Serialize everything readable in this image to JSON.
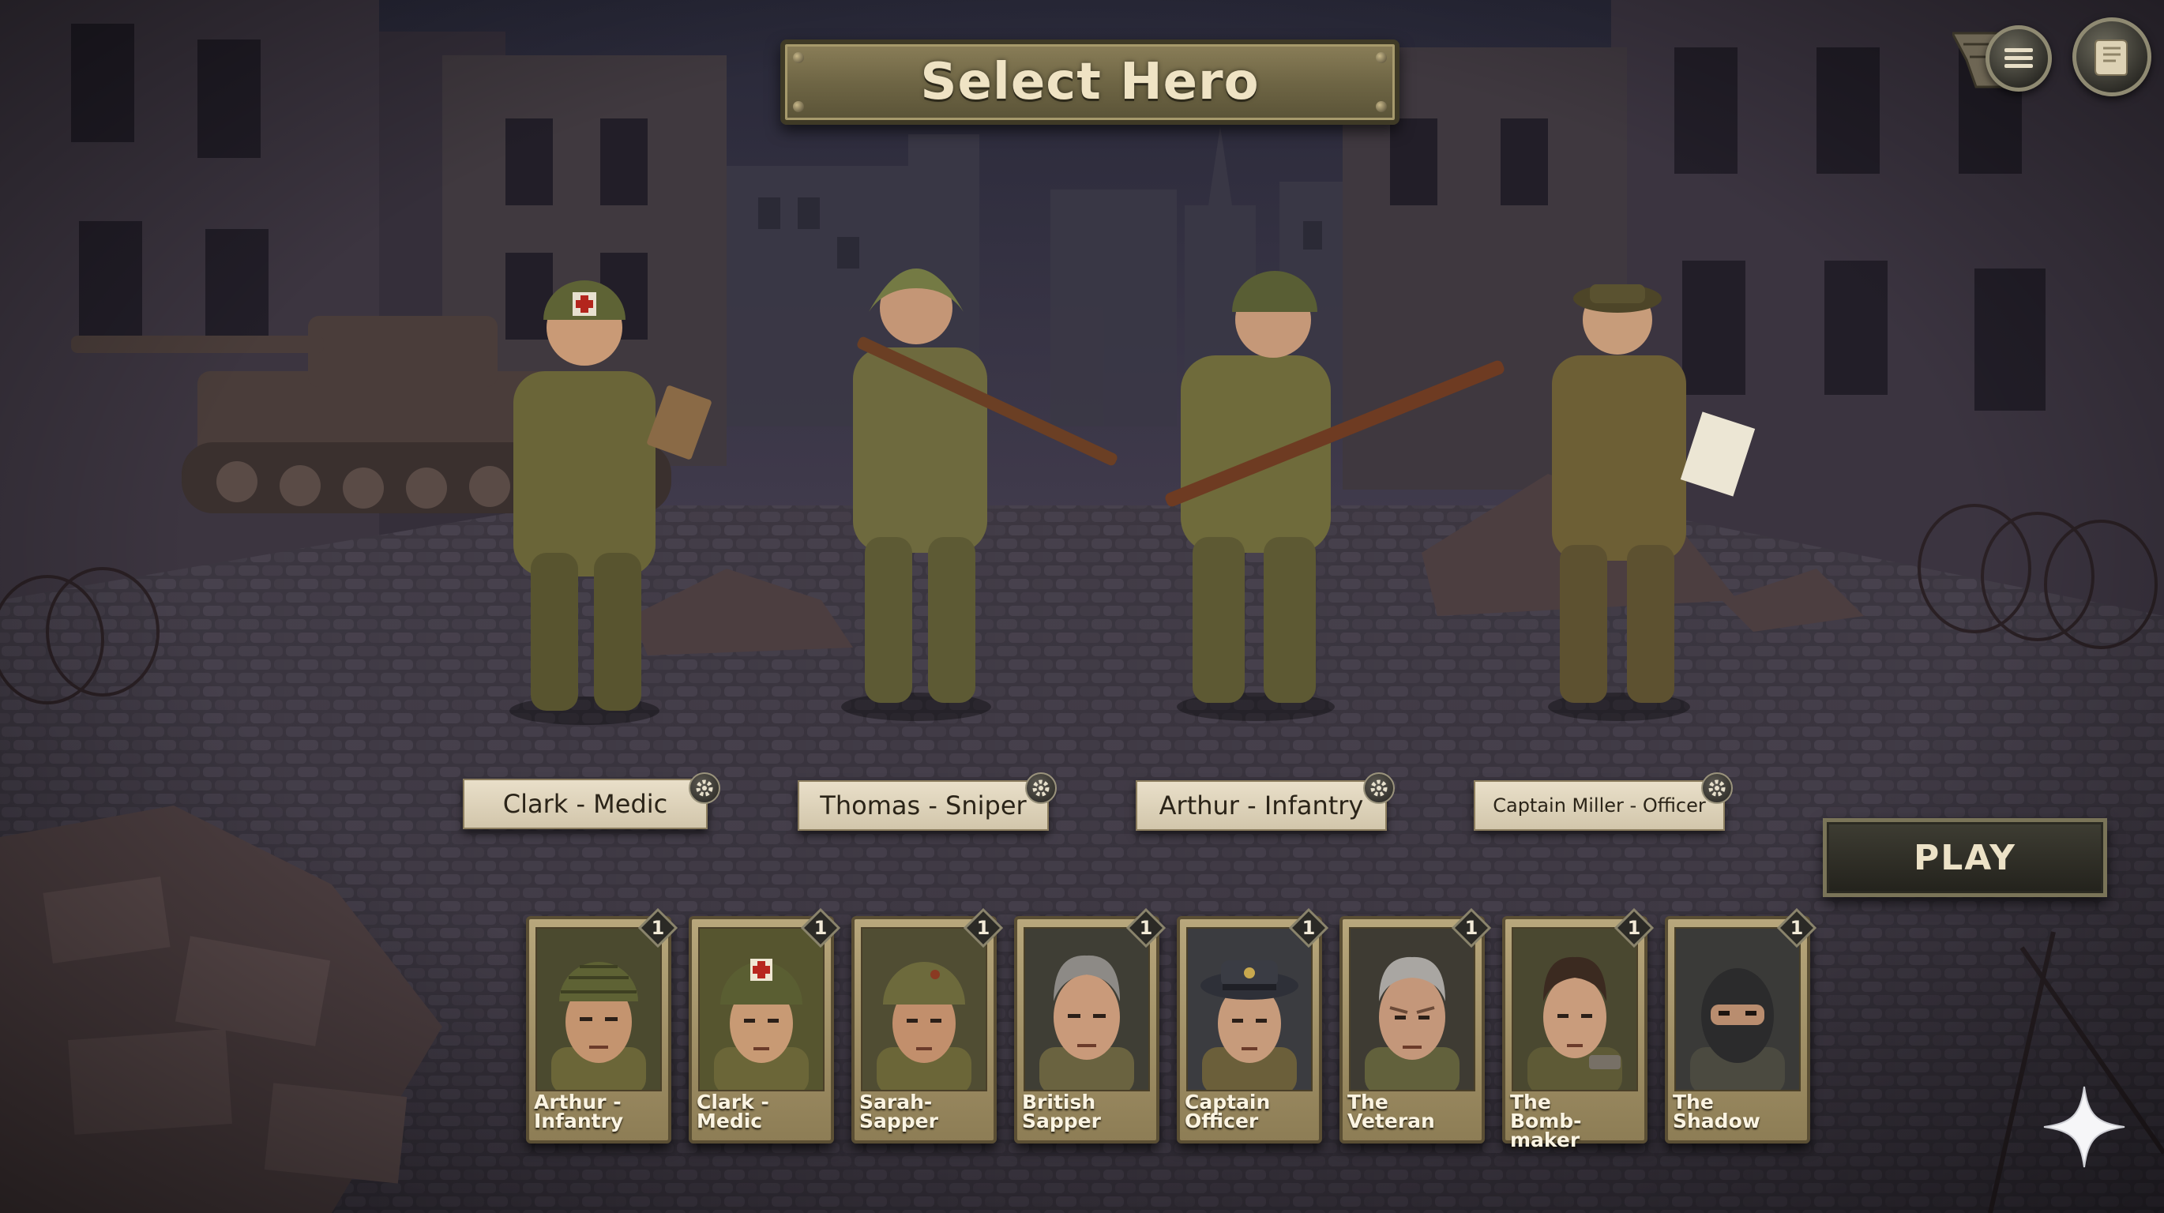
{
  "title": "Select Hero",
  "menu_icon": "hamburger-menu-icon",
  "map_icon": "scroll-map-icon",
  "selected_heroes": [
    {
      "label": "Clark - Medic",
      "role": "medic"
    },
    {
      "label": "Thomas - Sniper",
      "role": "sniper"
    },
    {
      "label": "Arthur - Infantry",
      "role": "infantry"
    },
    {
      "label": "Captain Miller - Officer",
      "role": "officer"
    }
  ],
  "play_label": "PLAY",
  "roster": [
    {
      "line1": "Arthur -",
      "line2": "Infantry",
      "level": "1",
      "portrait": "helmet-netted"
    },
    {
      "line1": "Clark -",
      "line2": "Medic",
      "level": "1",
      "portrait": "helmet-red-cross"
    },
    {
      "line1": "Sarah-",
      "line2": "Sapper",
      "level": "1",
      "portrait": "helmet-plain"
    },
    {
      "line1": "British",
      "line2": "Sapper",
      "level": "1",
      "portrait": "bare-grey-hair"
    },
    {
      "line1": "Captain",
      "line2": "Officer",
      "level": "1",
      "portrait": "officer-cap"
    },
    {
      "line1": "The",
      "line2": "Veteran",
      "level": "1",
      "portrait": "bare-old"
    },
    {
      "line1": "The",
      "line2": "Bomb-maker",
      "level": "1",
      "portrait": "bare-dark-hair"
    },
    {
      "line1": "The",
      "line2": "Shadow",
      "level": "1",
      "portrait": "balaclava"
    }
  ],
  "colors": {
    "parchment": "#e9dfc9",
    "olive": "#5f6436",
    "plaque": "#7a7050",
    "sky_top": "#2c2c40",
    "sky_bottom": "#5a4a55"
  }
}
